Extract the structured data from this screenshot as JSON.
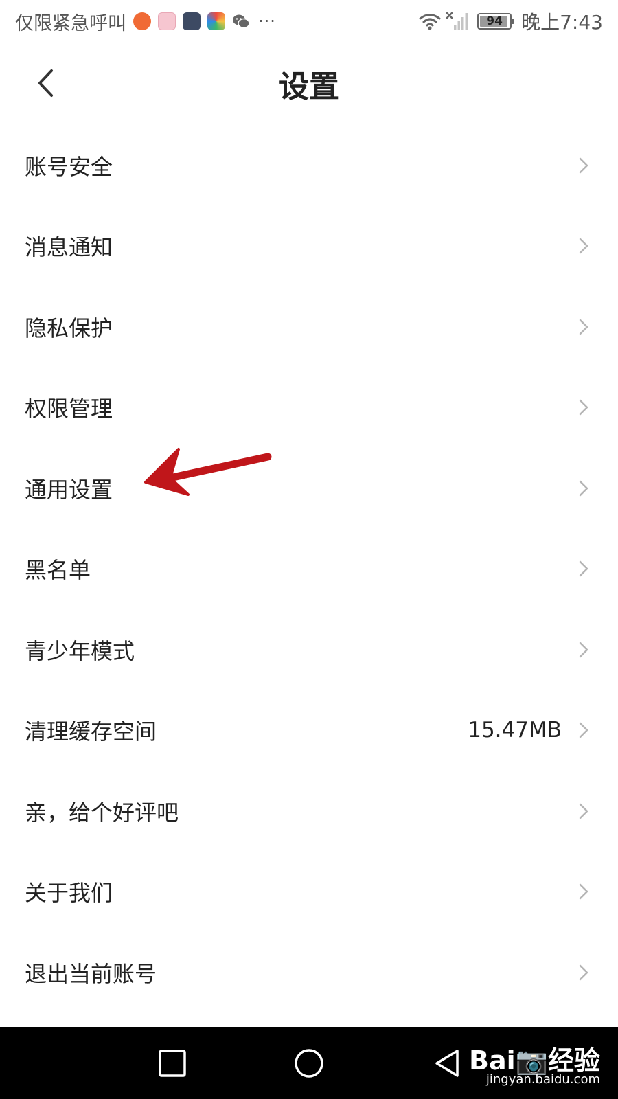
{
  "status_bar": {
    "carrier": "仅限紧急呼叫",
    "more": "···",
    "battery": "94",
    "battery_level": 0.94,
    "time": "晚上7:43"
  },
  "header": {
    "title": "设置"
  },
  "settings": {
    "items": [
      {
        "label": "账号安全"
      },
      {
        "label": "消息通知"
      },
      {
        "label": "隐私保护"
      },
      {
        "label": "权限管理"
      },
      {
        "label": "通用设置"
      },
      {
        "label": "黑名单"
      },
      {
        "label": "青少年模式"
      },
      {
        "label": "清理缓存空间",
        "value": "15.47MB"
      },
      {
        "label": "亲，给个好评吧"
      },
      {
        "label": "关于我们"
      },
      {
        "label": "退出当前账号"
      }
    ]
  },
  "watermark": {
    "logo": "Bai📷经验",
    "url": "jingyan.baidu.com"
  },
  "colors": {
    "annotation_arrow": "#c0161a",
    "nav_background": "#000000",
    "chevron": "#b5b5b5"
  }
}
